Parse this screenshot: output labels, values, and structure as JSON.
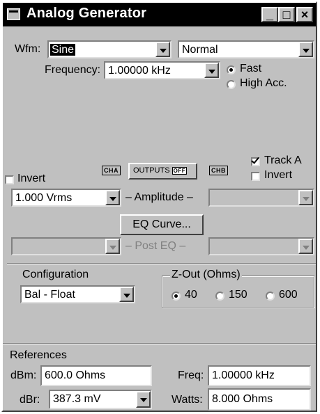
{
  "window": {
    "title": "Analog Generator",
    "minimize": "_",
    "maximize": "□",
    "close": "×"
  },
  "waveform": {
    "label": "Wfm:",
    "value": "Sine",
    "mode": "Normal"
  },
  "frequency": {
    "label": "Frequency:",
    "value": "1.00000 kHz",
    "options": [
      "Fast",
      "High Acc."
    ],
    "selected": "Fast"
  },
  "outputs": {
    "invert_a_label": "Invert",
    "cha": "CHA",
    "outputs_label": "OUTPUTS",
    "outputs_state": "OFF",
    "chb": "CHB",
    "track_a_label": "Track A",
    "track_a_checked": true,
    "invert_b_label": "Invert"
  },
  "amplitude": {
    "value_a": "1.000  Vrms",
    "label": "– Amplitude –",
    "value_b": ""
  },
  "eq": {
    "button": "EQ Curve...",
    "post_eq_label": "– Post EQ –"
  },
  "configuration": {
    "label": "Configuration",
    "value": "Bal - Float"
  },
  "zout": {
    "label": "Z-Out (Ohms)",
    "options": [
      "40",
      "150",
      "600"
    ],
    "selected": "40"
  },
  "references": {
    "label": "References",
    "dbm_label": "dBm:",
    "dbm_value": "600.0   Ohms",
    "dbr_label": "dBr:",
    "dbr_value": "387.3   mV",
    "freq_label": "Freq:",
    "freq_value": "1.00000 kHz",
    "watts_label": "Watts:",
    "watts_value": "8.000   Ohms"
  }
}
